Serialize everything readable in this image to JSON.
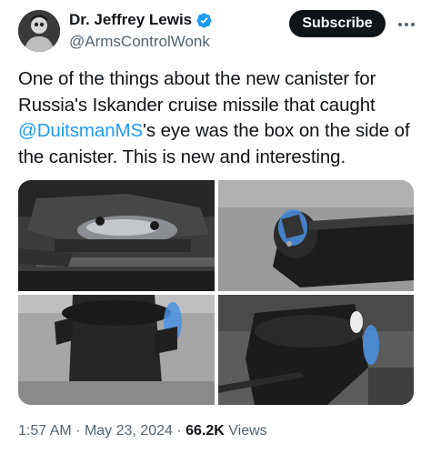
{
  "author": {
    "display_name": "Dr. Jeffrey Lewis",
    "handle": "@ArmsControlWonk",
    "verified": true,
    "verified_color": "#1d9bf0"
  },
  "actions": {
    "subscribe_label": "Subscribe",
    "more_icon": "more-horizontal-icon"
  },
  "tweet": {
    "text_before": "One of the things about the new canister for Russia's Iskander cruise missile that caught ",
    "mention": "@DuitsmanMS",
    "text_after": "'s eye was the box on the side of the canister. This is new and interesting."
  },
  "media": {
    "photo_count": 4,
    "highlight_color": "#4a90e2"
  },
  "meta": {
    "time": "1:57 AM",
    "date": "May 23, 2024",
    "separator": "·",
    "views_count": "66.2K",
    "views_label": "Views"
  },
  "colors": {
    "text": "#0f1419",
    "secondary": "#536471",
    "accent": "#1d9bf0"
  }
}
